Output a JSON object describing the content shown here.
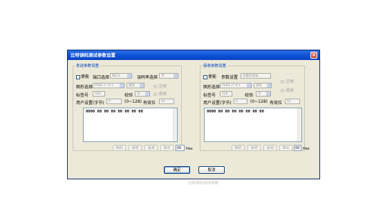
{
  "window": {
    "title": "比特误码测试参数设置"
  },
  "send": {
    "group_title": "发送参数设置",
    "enable_label": "使能",
    "port_label": "端口选择",
    "port_value": "端口1",
    "rate_label": "误码率选择",
    "rate_value": "无",
    "pattern_label": "图形选择",
    "pattern_value": "PRBS 2^9-1",
    "pattern_mode_value": "通常",
    "radio_inject": "注帧",
    "radio_frame": "成帧",
    "tag_label": "标签号",
    "tag_value": "000",
    "check_label": "校验",
    "check_value": "否",
    "user_label": "用户设置(字节)",
    "user_value": "0",
    "range": "(0~128)",
    "valid_label": "有效位",
    "valid_value": "64",
    "data": "0000 00 00 00 00 00 00 00",
    "btn_random": "随机",
    "btn_inc": "递增",
    "btn_dec": "递减",
    "btn_fill": "填充",
    "hex_value": "00",
    "hex_label": "Hex"
  },
  "recv": {
    "group_title": "接收参数设置",
    "enable_label": "使能",
    "param_label": "参数设置",
    "param_value": "设置同发送",
    "pattern_label": "图形选择",
    "pattern_value": "PRBS 2^9-1",
    "pattern_mode_value": "通常",
    "radio_inject": "注帧",
    "radio_frame": "成帧",
    "tag_label": "标签号",
    "tag_value": "000",
    "check_label": "校验",
    "check_value": "否",
    "user_label": "用户设置(字节)",
    "user_value": "0",
    "range": "(0~128)",
    "valid_label": "有效位",
    "valid_value": "64",
    "data": "0000 00 00 00 00 00 00 00",
    "btn_random": "随机",
    "btn_inc": "递增",
    "btn_dec": "递减",
    "btn_fill": "填充",
    "hex_value": "00",
    "hex_label": "Hex"
  },
  "buttons": {
    "ok": "确定",
    "cancel": "取消"
  },
  "caption": "比特误码测试参数"
}
